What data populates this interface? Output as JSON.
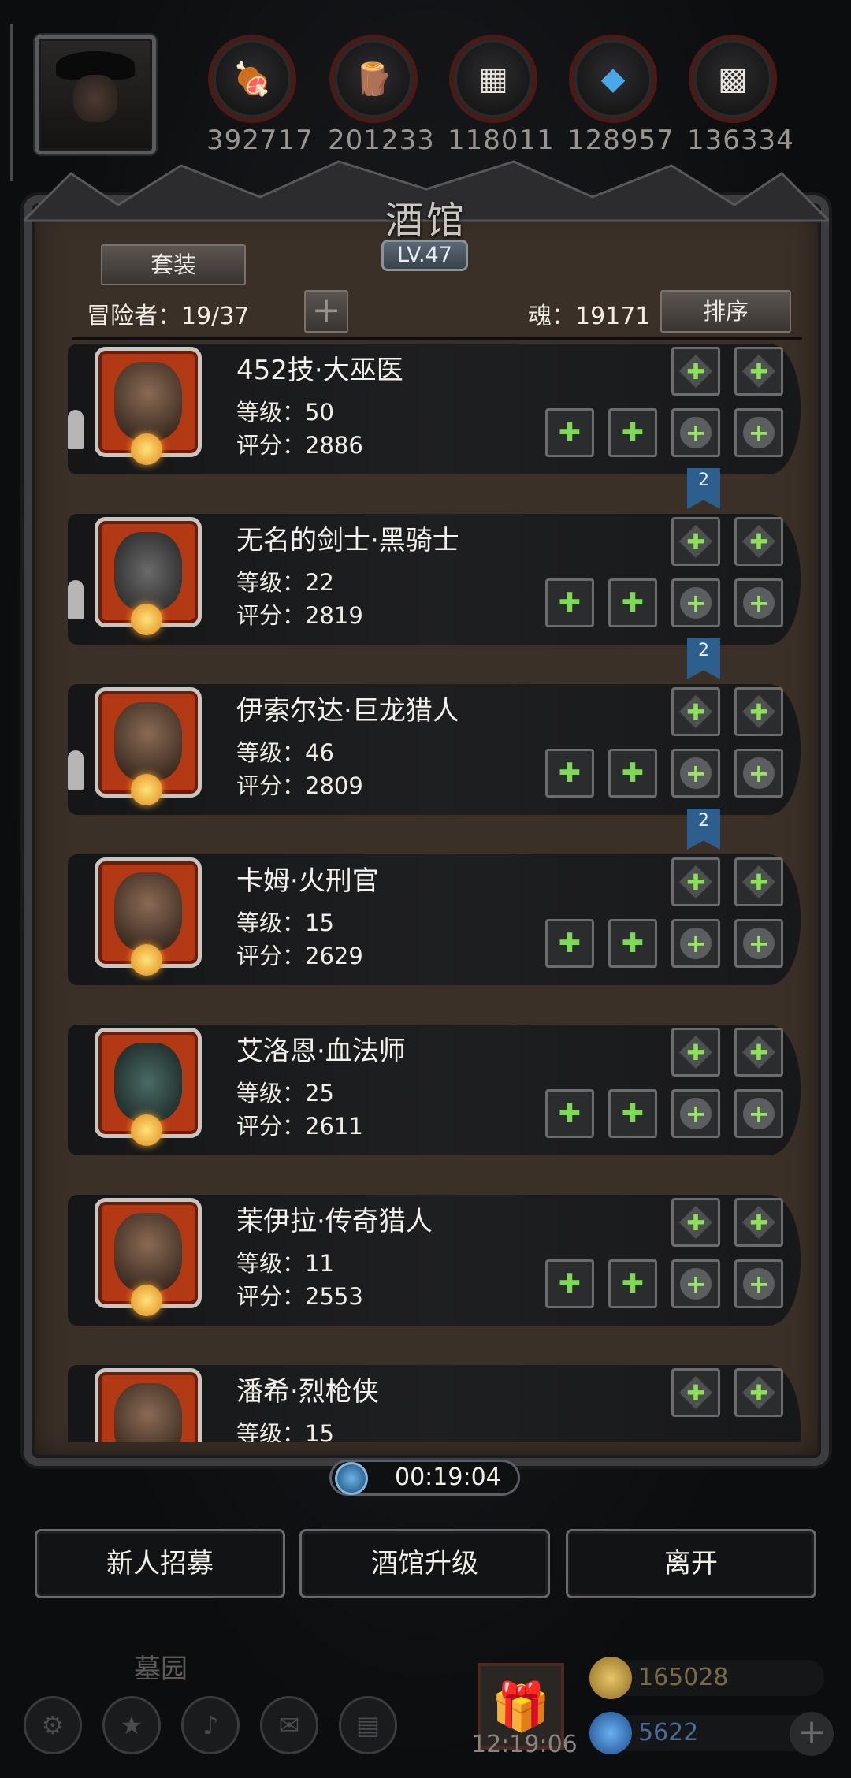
{
  "resources": [
    {
      "icon": "meat-icon",
      "value": "392717"
    },
    {
      "icon": "wood-icon",
      "value": "201233"
    },
    {
      "icon": "iron-icon",
      "value": "118011"
    },
    {
      "icon": "crystal-icon",
      "value": "128957"
    },
    {
      "icon": "stone-icon",
      "value": "136334"
    }
  ],
  "panel": {
    "title": "酒馆",
    "level": "LV.47",
    "suit_label": "套装",
    "adventurers_label": "冒险者：19/37",
    "soul_label": "魂：19171",
    "sort_label": "排序",
    "add_symbol": "+"
  },
  "heroes": [
    {
      "name": "452技·大巫医",
      "level": "等级：50",
      "score": "评分：2886"
    },
    {
      "name": "无名的剑士·黑骑士",
      "level": "等级：22",
      "score": "评分：2819"
    },
    {
      "name": "伊索尔达·巨龙猎人",
      "level": "等级：46",
      "score": "评分：2809"
    },
    {
      "name": "卡姆·火刑官",
      "level": "等级：15",
      "score": "评分：2629"
    },
    {
      "name": "艾洛恩·血法师",
      "level": "等级：25",
      "score": "评分：2611"
    },
    {
      "name": "茉伊拉·传奇猎人",
      "level": "等级：11",
      "score": "评分：2553"
    },
    {
      "name": "潘希·烈枪侠",
      "level": "等级：15",
      "score": ""
    }
  ],
  "bookmarks": [
    "2",
    "2",
    "2"
  ],
  "timer": "00:19:04",
  "buttons": {
    "recruit": "新人招募",
    "upgrade": "酒馆升级",
    "leave": "离开"
  },
  "footer": {
    "location": "墓园",
    "clock": "12:19:06",
    "gold": "165028",
    "gems": "5622"
  },
  "colors": {
    "accent_green": "#7fd858",
    "portrait_orange": "#b33814",
    "bookmark_blue": "#2c5f8e"
  }
}
